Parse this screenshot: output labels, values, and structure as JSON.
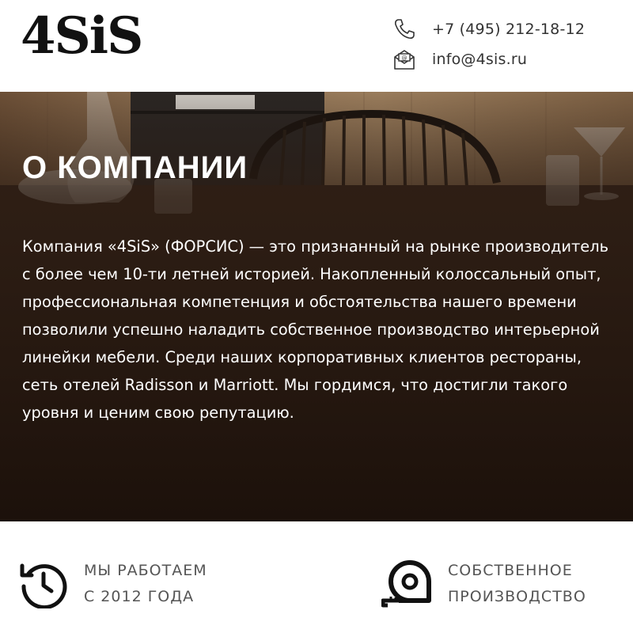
{
  "header": {
    "logo": "4SiS",
    "phone": {
      "icon": "phone-icon",
      "text": "+7 (495) 212-18-12"
    },
    "email": {
      "icon": "mail-icon",
      "text": "info@4sis.ru"
    }
  },
  "hero": {
    "title": "О КОМПАНИИ",
    "text": "Компания «4SiS» (ФОРСИС) — это признанный на рынке производитель с более чем 10-ти летней историей. Накопленный колоссальный опыт, профессиональная компетенция и обстоятельства нашего времени позволили успешно наладить собственное производство интерьерной линейки мебели. Среди наших корпоративных клиентов рестораны, сеть отелей Radisson и Marriott. Мы гордимся, что достигли такого уровня и ценим свою репутацию."
  },
  "features": [
    {
      "icon": "history-clock-icon",
      "line1": "МЫ РАБОТАЕМ",
      "line2": "С 2012 ГОДА"
    },
    {
      "icon": "tape-measure-icon",
      "line1": "СОБСТВЕННОЕ",
      "line2": "ПРОИЗВОДСТВО"
    }
  ],
  "colors": {
    "overlay": "#2a1b12",
    "text_light": "#ffffff",
    "text_dark": "#333333"
  }
}
